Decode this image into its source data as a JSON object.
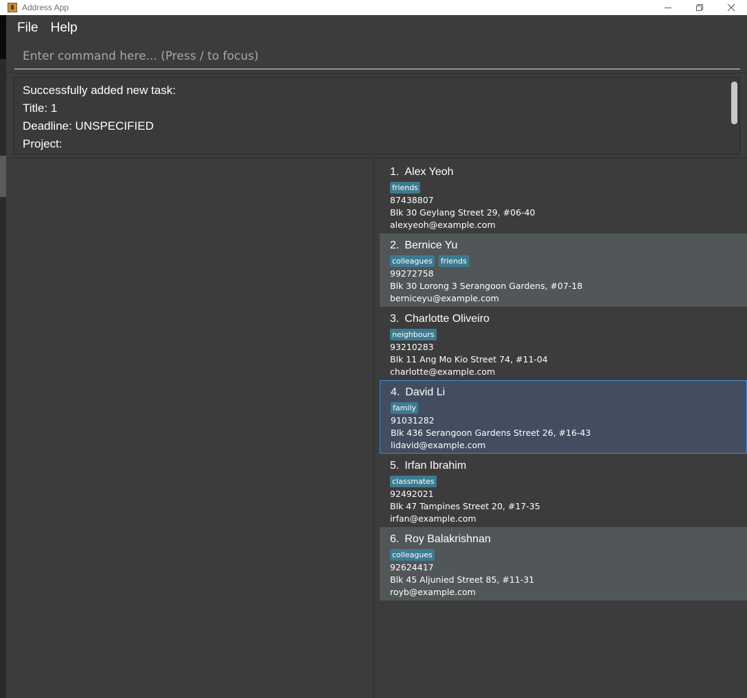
{
  "window": {
    "title": "Address App"
  },
  "menu": {
    "items": [
      "File",
      "Help"
    ]
  },
  "command": {
    "placeholder": "Enter command here... (Press / to focus)",
    "value": ""
  },
  "result": {
    "lines": [
      "Successfully added new task:",
      "Title: 1",
      "Deadline: UNSPECIFIED",
      "Project:"
    ]
  },
  "persons": [
    {
      "index": "1.",
      "name": "Alex Yeoh",
      "tags": [
        "friends"
      ],
      "phone": "87438807",
      "address": "Blk 30 Geylang Street 29, #06-40",
      "email": "alexyeoh@example.com"
    },
    {
      "index": "2.",
      "name": "Bernice Yu",
      "tags": [
        "colleagues",
        "friends"
      ],
      "phone": "99272758",
      "address": "Blk 30 Lorong 3 Serangoon Gardens, #07-18",
      "email": "berniceyu@example.com"
    },
    {
      "index": "3.",
      "name": "Charlotte Oliveiro",
      "tags": [
        "neighbours"
      ],
      "phone": "93210283",
      "address": "Blk 11 Ang Mo Kio Street 74, #11-04",
      "email": "charlotte@example.com"
    },
    {
      "index": "4.",
      "name": "David Li",
      "tags": [
        "family"
      ],
      "phone": "91031282",
      "address": "Blk 436 Serangoon Gardens Street 26, #16-43",
      "email": "lidavid@example.com"
    },
    {
      "index": "5.",
      "name": "Irfan Ibrahim",
      "tags": [
        "classmates"
      ],
      "phone": "92492021",
      "address": "Blk 47 Tampines Street 20, #17-35",
      "email": "irfan@example.com"
    },
    {
      "index": "6.",
      "name": "Roy Balakrishnan",
      "tags": [
        "colleagues"
      ],
      "phone": "92624417",
      "address": "Blk 45 Aljunied Street 85, #11-31",
      "email": "royb@example.com"
    }
  ],
  "selected_index": 3,
  "colors": {
    "background": "#3c3c3c",
    "card_alt": "#515658",
    "selected_card": "#424d5f",
    "selected_border": "#3d8fd6",
    "tag": "#3e7b91"
  }
}
